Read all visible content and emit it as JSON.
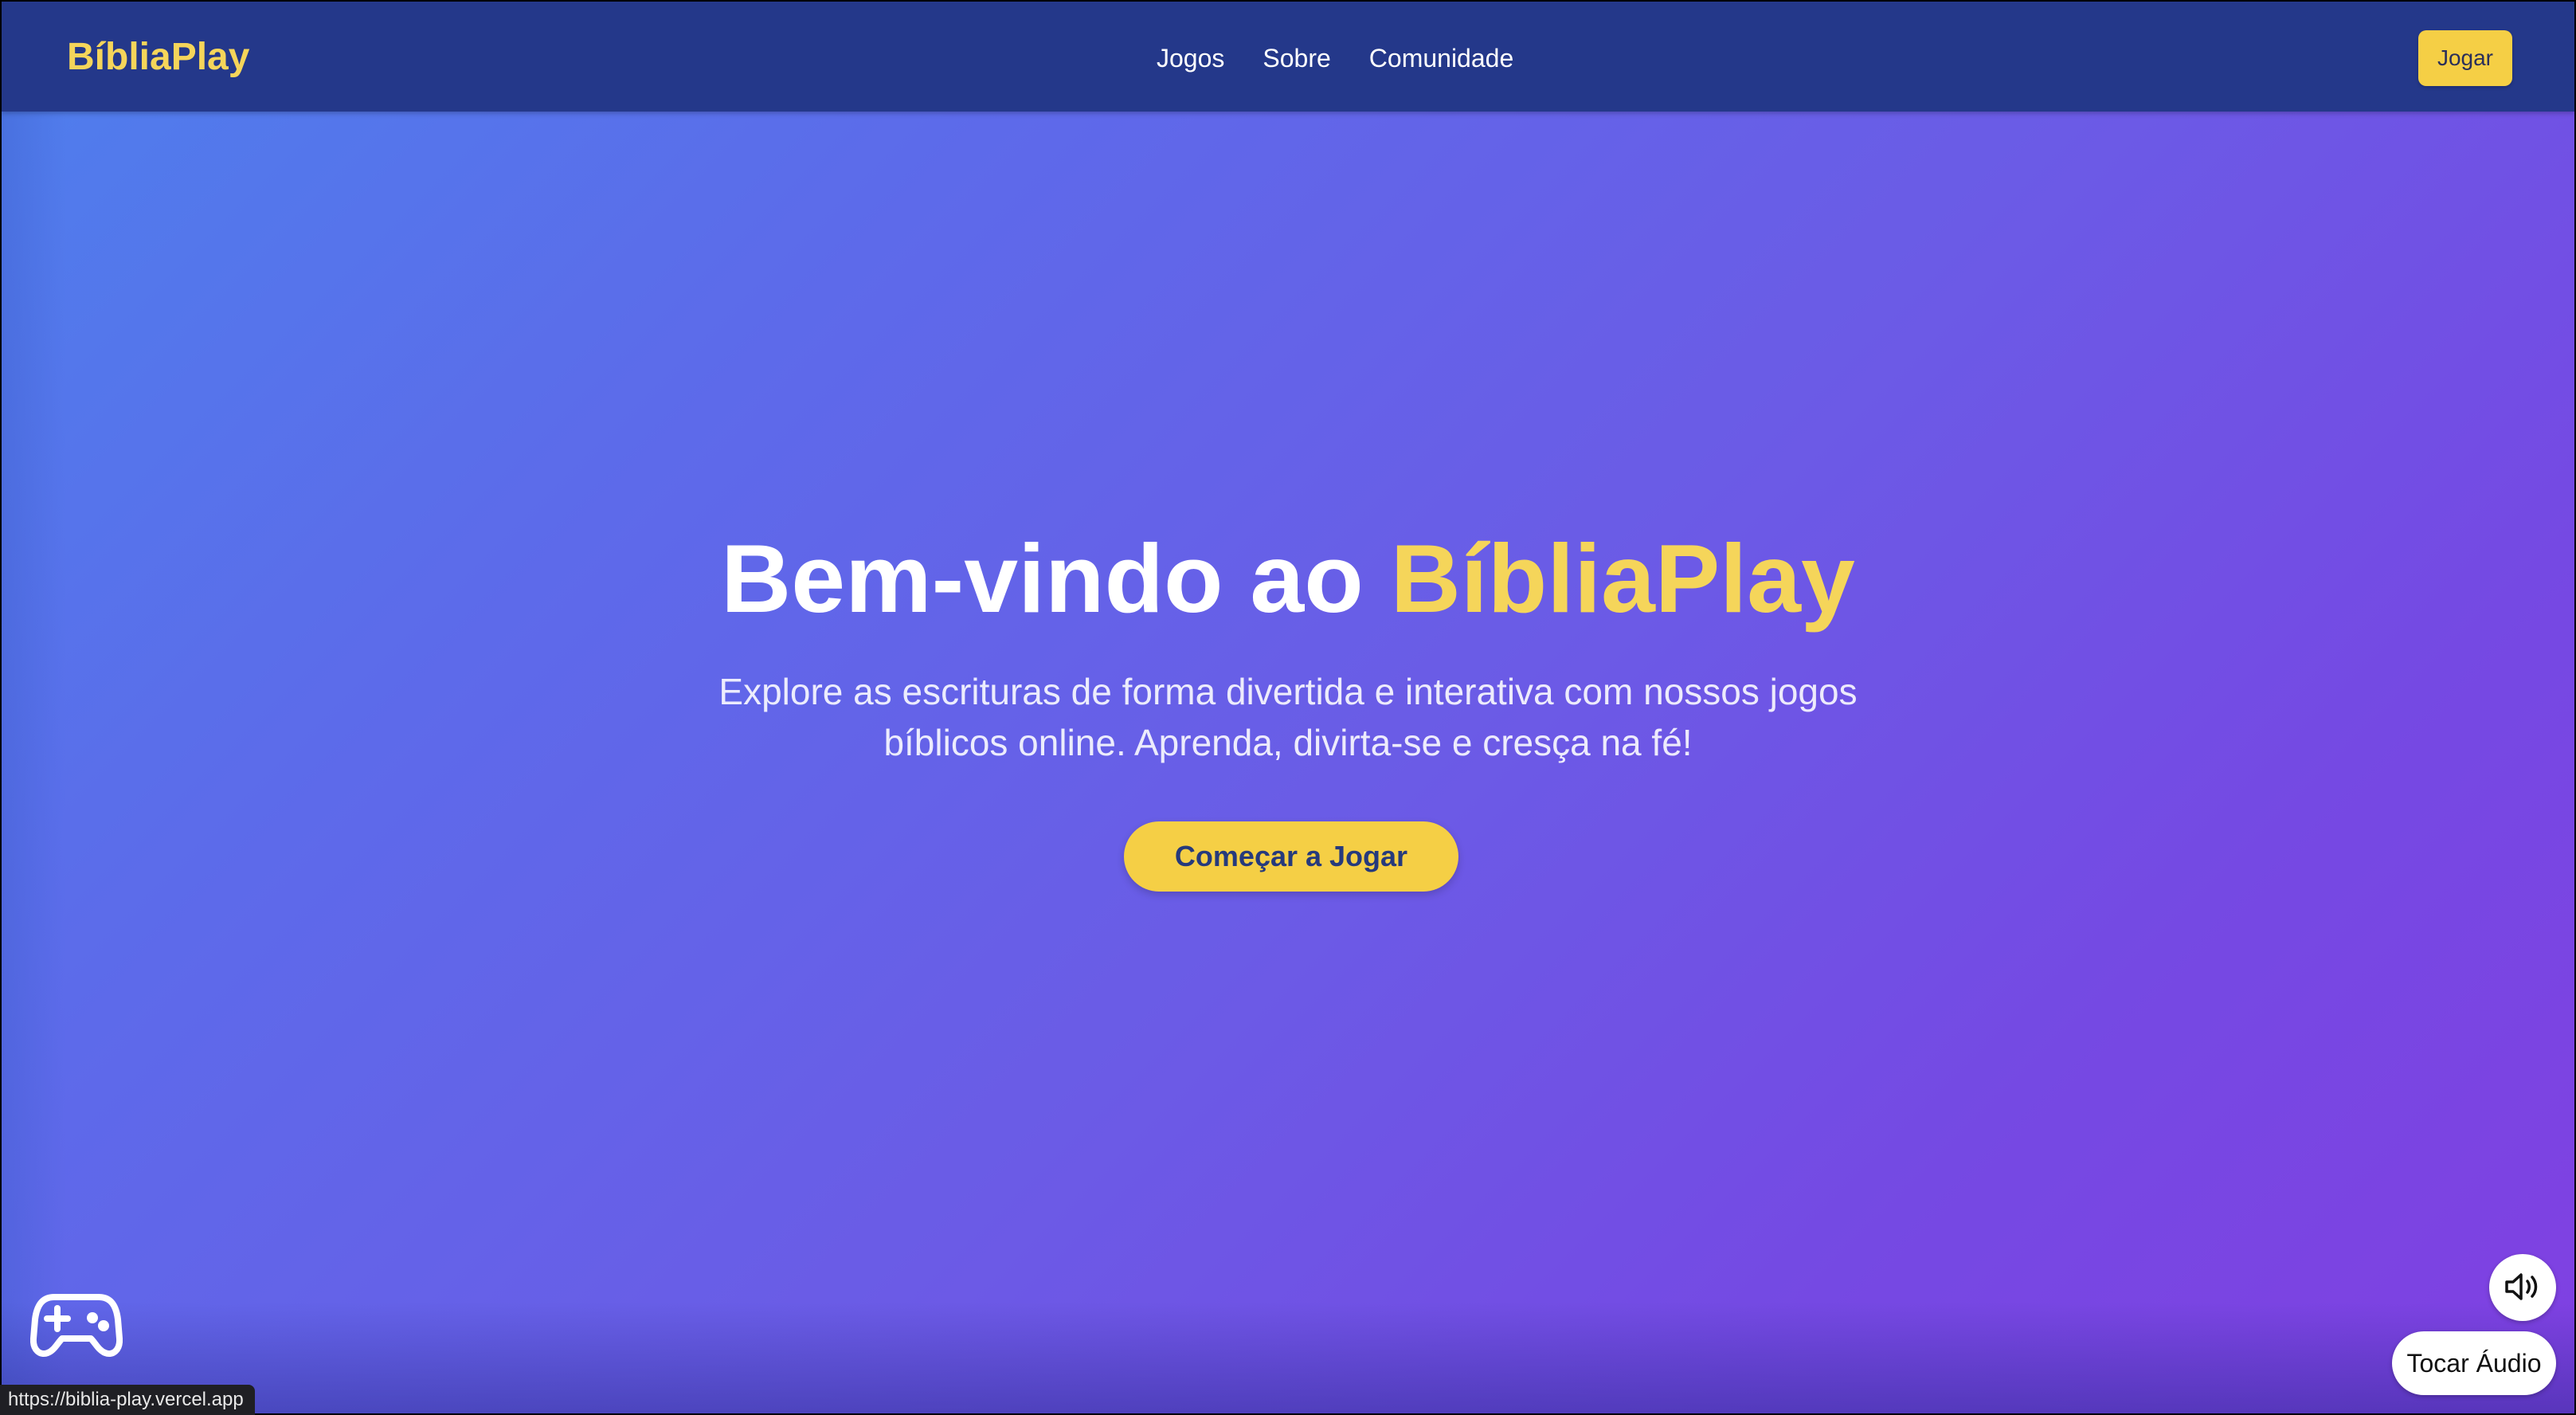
{
  "nav": {
    "brand": "BíbliaPlay",
    "links": [
      "Jogos",
      "Sobre",
      "Comunidade"
    ],
    "cta_label": "Jogar"
  },
  "hero": {
    "title_prefix": "Bem-vindo ao ",
    "title_accent": "BíbliaPlay",
    "subtitle": "Explore as escrituras de forma divertida e interativa com nossos jogos bíblicos online. Aprenda, divirta-se e cresça na fé!",
    "cta_label": "Começar a Jogar"
  },
  "floating": {
    "gamepad_icon": "gamepad-icon",
    "audio_icon": "speaker-icon",
    "audio_label": "Tocar Áudio"
  },
  "status_bar": {
    "url": "https://biblia-play.vercel.app"
  },
  "colors": {
    "nav_bg": "#24388a",
    "accent_yellow": "#f5d55a",
    "button_yellow": "#f5cf45",
    "gradient_start": "#4e7fec",
    "gradient_end": "#8040e2"
  }
}
